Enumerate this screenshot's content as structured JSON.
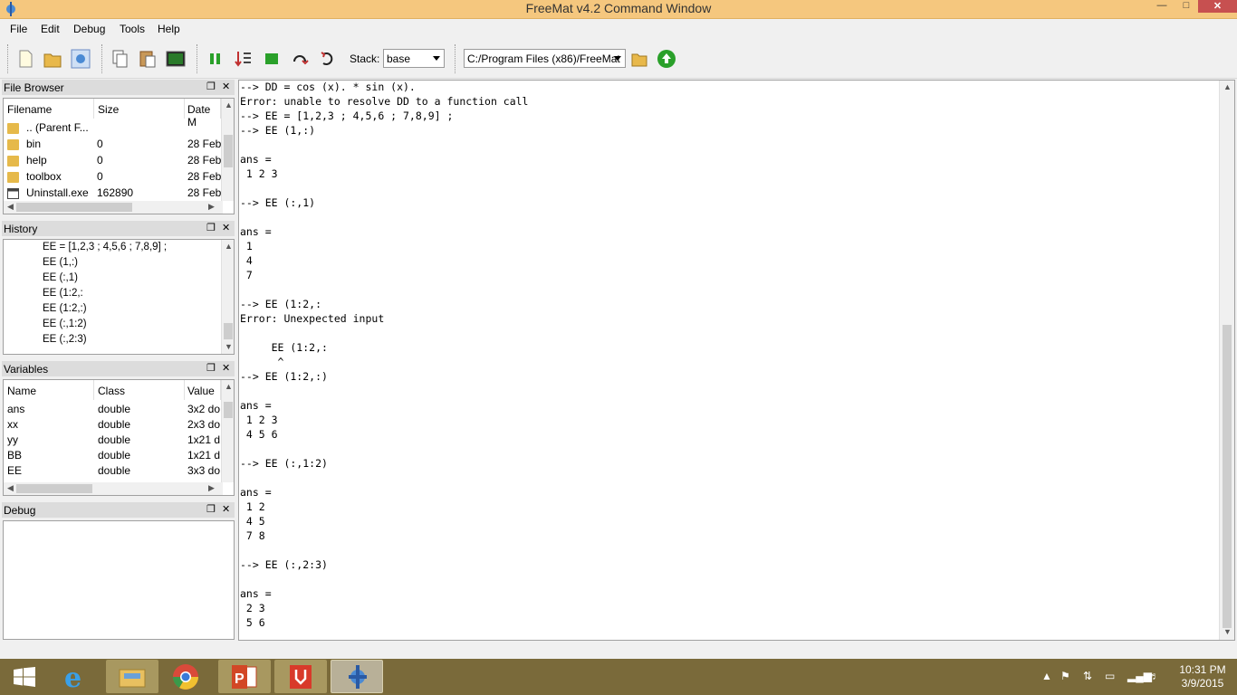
{
  "window": {
    "title": "FreeMat v4.2 Command Window"
  },
  "menu": [
    "File",
    "Edit",
    "Debug",
    "Tools",
    "Help"
  ],
  "toolbar": {
    "stack_label": "Stack:",
    "stack_value": "base",
    "path_value": "C:/Program Files (x86)/FreeMat"
  },
  "file_browser": {
    "title": "File Browser",
    "columns": [
      "Filename",
      "Size",
      "Date M"
    ],
    "rows": [
      {
        "name": ".. (Parent F...",
        "size": "",
        "date": ""
      },
      {
        "name": "bin",
        "size": "0",
        "date": "28 Feb"
      },
      {
        "name": "help",
        "size": "0",
        "date": "28 Feb"
      },
      {
        "name": "toolbox",
        "size": "0",
        "date": "28 Feb"
      },
      {
        "name": "Uninstall.exe",
        "size": "162890",
        "date": "28 Feb"
      }
    ]
  },
  "history": {
    "title": "History",
    "items": [
      "EE = [1,2,3 ; 4,5,6 ; 7,8,9] ;",
      "EE (1,:)",
      "EE (:,1)",
      "EE (1:2,:",
      "EE (1:2,:)",
      "EE (:,1:2)",
      "EE (:,2:3)"
    ]
  },
  "variables": {
    "title": "Variables",
    "columns": [
      "Name",
      "Class",
      "Value"
    ],
    "rows": [
      {
        "name": "ans",
        "class": "double",
        "value": "3x2 do"
      },
      {
        "name": "xx",
        "class": "double",
        "value": "2x3 do"
      },
      {
        "name": "yy",
        "class": "double",
        "value": "1x21 d"
      },
      {
        "name": "BB",
        "class": "double",
        "value": "1x21 d"
      },
      {
        "name": "EE",
        "class": "double",
        "value": "3x3 do"
      }
    ]
  },
  "debug": {
    "title": "Debug"
  },
  "console": {
    "lines": [
      "--> DD = cos (x). * sin (x).",
      "Error: unable to resolve DD to a function call",
      "--> EE = [1,2,3 ; 4,5,6 ; 7,8,9] ;",
      "--> EE (1,:)",
      "",
      "ans =",
      " 1 2 3",
      "",
      "--> EE (:,1)",
      "",
      "ans =",
      " 1",
      " 4",
      " 7",
      "",
      "--> EE (1:2,:",
      "Error: Unexpected input",
      "",
      "     EE (1:2,:",
      "      ^",
      "--> EE (1:2,:)",
      "",
      "ans =",
      " 1 2 3",
      " 4 5 6",
      "",
      "--> EE (:,1:2)",
      "",
      "ans =",
      " 1 2",
      " 4 5",
      " 7 8",
      "",
      "--> EE (:,2:3)",
      "",
      "ans =",
      " 2 3",
      " 5 6"
    ]
  },
  "taskbar": {
    "time": "10:31 PM",
    "date": "3/9/2015"
  },
  "colors": {
    "titlebar": "#f5c77e",
    "taskbar": "#7a6a3a",
    "folder": "#e6b94a"
  }
}
